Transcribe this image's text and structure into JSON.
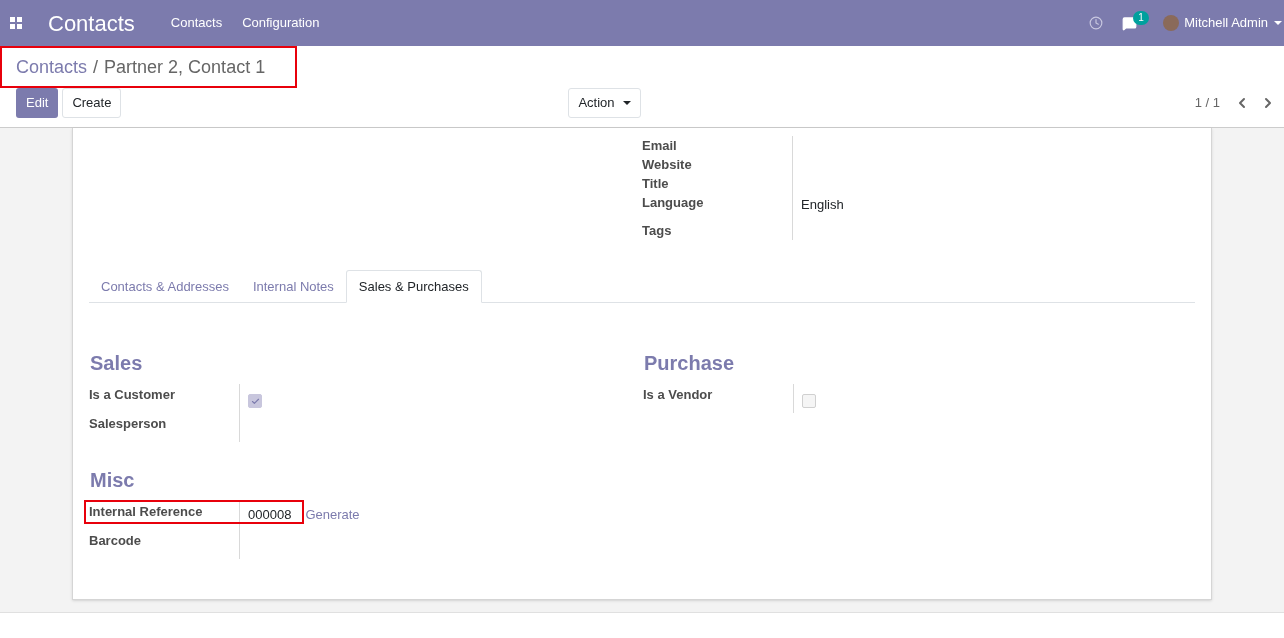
{
  "app": {
    "title": "Contacts",
    "menu": [
      "Contacts",
      "Configuration"
    ],
    "messages_count": "1",
    "user": "Mitchell Admin"
  },
  "breadcrumb": {
    "parent": "Contacts",
    "separator": "/",
    "current": "Partner 2, Contact 1",
    "highlighted": true
  },
  "buttons": {
    "edit": "Edit",
    "create": "Create",
    "action": "Action"
  },
  "pager": "1 / 1",
  "top_fields": [
    {
      "label": "Email"
    },
    {
      "label": "Website"
    },
    {
      "label": "Title"
    },
    {
      "label": "Language",
      "value": "English"
    },
    {
      "label": "Tags"
    }
  ],
  "tabs": [
    {
      "label": "Contacts & Addresses",
      "selected": false
    },
    {
      "label": "Internal Notes",
      "selected": false
    },
    {
      "label": "Sales & Purchases",
      "selected": true
    }
  ],
  "sections": [
    {
      "title": "Sales",
      "fields": [
        {
          "kind": "checkbox",
          "label": "Is a Customer",
          "checked": true
        },
        {
          "kind": "text",
          "label": "Salesperson"
        }
      ]
    },
    {
      "title": "Purchase",
      "fields": [
        {
          "kind": "checkbox",
          "label": "Is a Vendor",
          "checked": false
        }
      ]
    }
  ],
  "misc": {
    "title": "Misc",
    "fields": [
      {
        "kind": "text",
        "label": "Internal Reference",
        "value": "000008",
        "link": "Generate",
        "highlighted": true
      },
      {
        "kind": "text",
        "label": "Barcode",
        "highlighted": false
      }
    ]
  }
}
